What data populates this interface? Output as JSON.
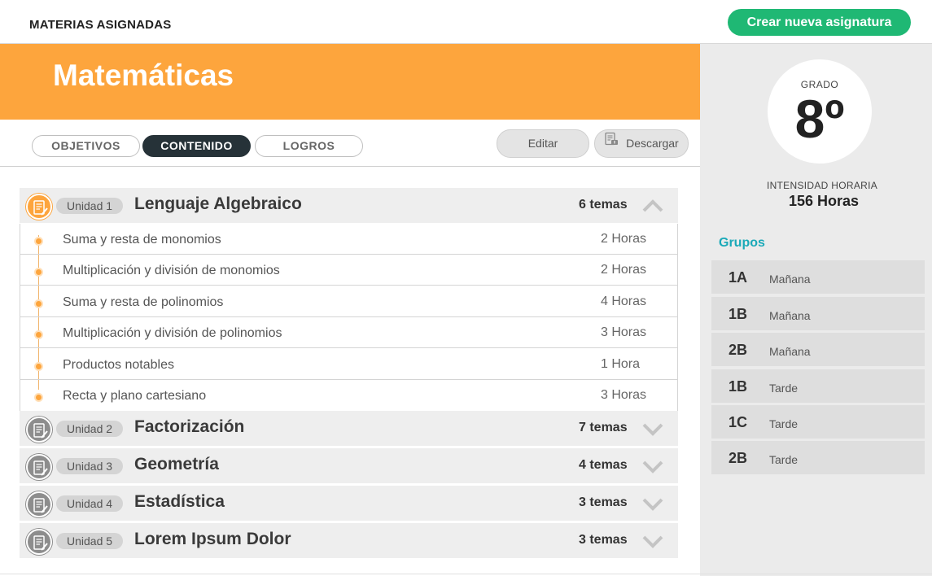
{
  "header": {
    "section_title": "MATERIAS ASIGNADAS",
    "create_button": "Crear nueva asignatura"
  },
  "subject": {
    "title": "Matemáticas"
  },
  "tabs": [
    {
      "label": "OBJETIVOS",
      "active": false
    },
    {
      "label": "CONTENIDO",
      "active": true
    },
    {
      "label": "LOGROS",
      "active": false
    }
  ],
  "actions": {
    "edit": "Editar",
    "download": "Descargar"
  },
  "units": [
    {
      "badge": "Unidad 1",
      "name": "Lenguaje Algebraico",
      "count": "6 temas",
      "expanded": true,
      "topics": [
        {
          "name": "Suma y resta de monomios",
          "hours": "2 Horas"
        },
        {
          "name": "Multiplicación y división de monomios",
          "hours": "2 Horas"
        },
        {
          "name": "Suma y resta de polinomios",
          "hours": "4 Horas"
        },
        {
          "name": "Multiplicación y división de polinomios",
          "hours": "3 Horas"
        },
        {
          "name": "Productos notables",
          "hours": "1 Hora"
        },
        {
          "name": "Recta y plano cartesiano",
          "hours": "3 Horas"
        }
      ]
    },
    {
      "badge": "Unidad 2",
      "name": "Factorización",
      "count": "7 temas",
      "expanded": false
    },
    {
      "badge": "Unidad 3",
      "name": "Geometría",
      "count": "4 temas",
      "expanded": false
    },
    {
      "badge": "Unidad 4",
      "name": "Estadística",
      "count": "3 temas",
      "expanded": false
    },
    {
      "badge": "Unidad 5",
      "name": "Lorem Ipsum Dolor",
      "count": "3 temas",
      "expanded": false
    }
  ],
  "sidebar": {
    "grade_label": "GRADO",
    "grade_value": "8º",
    "hours_label": "INTENSIDAD HORARIA",
    "hours_value": "156 Horas",
    "groups_title": "Grupos",
    "groups": [
      {
        "code": "1A",
        "shift": "Mañana"
      },
      {
        "code": "1B",
        "shift": "Mañana"
      },
      {
        "code": "2B",
        "shift": "Mañana"
      },
      {
        "code": "1B",
        "shift": "Tarde"
      },
      {
        "code": "1C",
        "shift": "Tarde"
      },
      {
        "code": "2B",
        "shift": "Tarde"
      }
    ]
  },
  "colors": {
    "accent_orange": "#fda53d",
    "create_green": "#1fb874",
    "active_tab": "#263238",
    "groups_teal": "#1aa9b8"
  }
}
